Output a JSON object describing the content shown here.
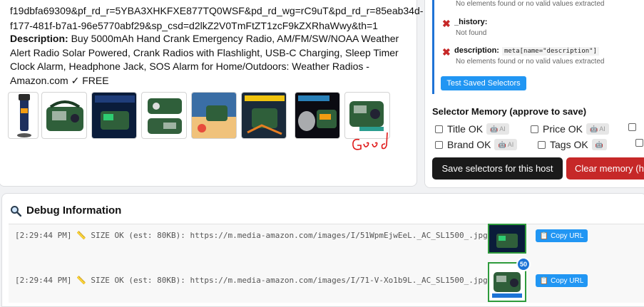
{
  "product": {
    "url_line_1": "f19dbfa69309&pf_rd_r=5YBA3XHKFXE877TQ0WSF&pd_rd_wg=rC9uT&pd_rd_r=85eab34d-",
    "url_line_2": "f177-481f-b7a1-96e5770abf29&sp_csd=d2lkZ2V0TmFtZT1zcF9kZXRhaWwy&th=1",
    "description_label": "Description:",
    "description_text": "Buy 5000mAh Hand Crank Emergency Radio, AM/FM/SW/NOAA Weather Alert Radio Solar Powered, Crank Radios with Flashlight, USB-C Charging, Sleep Timer Clock Alarm, Headphone Jack, SOS Alarm for Home/Outdoors: Weather Radios - Amazon.com ✓ FREE",
    "good_label": "Good"
  },
  "selectors": [
    {
      "name": "",
      "value": "",
      "note": "No elements found or no valid values extracted"
    },
    {
      "name": "_history:",
      "value": "",
      "note": "Not found"
    },
    {
      "name": "description:",
      "value": "meta[name=\"description\"]",
      "note": "No elements found or no valid values extracted"
    }
  ],
  "test_button": "Test Saved Selectors",
  "memory": {
    "title": "Selector Memory (approve to save)",
    "ai_label": "AI",
    "items": [
      "Title OK",
      "Price OK",
      "Brand OK",
      "Tags OK"
    ],
    "save_button": "Save selectors for this host",
    "clear_button": "Clear memory (h"
  },
  "debug": {
    "title": "Debug Information",
    "logs": [
      {
        "text": "[2:29:44 PM] 📏 SIZE OK (est: 80KB): https://m.media-amazon.com/images/I/51WpmEjwEeL._AC_SL1500_.jpg",
        "copy": "Copy URL"
      },
      {
        "text": "[2:29:44 PM] 📏 SIZE OK (est: 80KB): https://m.media-amazon.com/images/I/71-V-Xo1b9L._AC_SL1500_.jpg",
        "copy": "Copy URL",
        "badge": "50"
      }
    ]
  },
  "colors": {
    "accent": "#2196f3",
    "danger": "#c62828",
    "success": "#2e9b3c"
  }
}
